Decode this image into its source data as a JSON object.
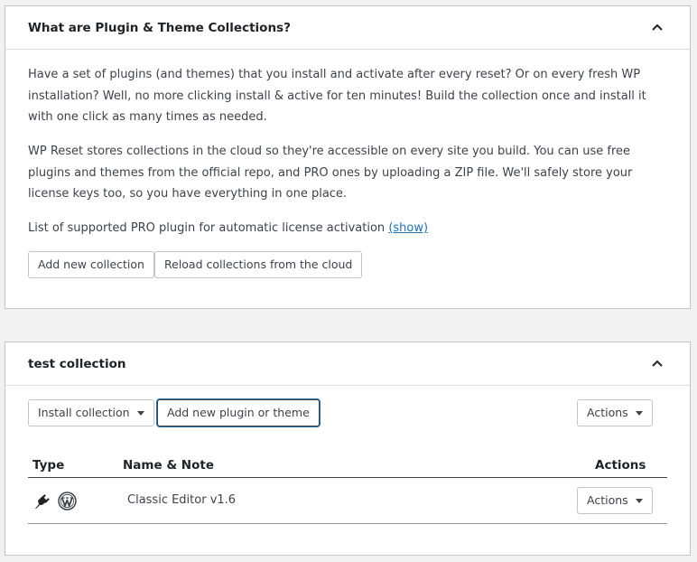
{
  "info_card": {
    "title": "What are Plugin & Theme Collections?",
    "paragraph1": "Have a set of plugins (and themes) that you install and activate after every reset? Or on every fresh WP installation? Well, no more clicking install & active for ten minutes! Build the collection once and install it with one click as many times as needed.",
    "paragraph2": "WP Reset stores collections in the cloud so they're accessible on every site you build. You can use free plugins and themes from the official repo, and PRO ones by uploading a ZIP file. We'll safely store your license keys too, so you have everything in one place.",
    "supported_text": "List of supported PRO plugin for automatic license activation",
    "show_link": "(show)",
    "add_collection_button": "Add new collection",
    "reload_button": "Reload collections from the cloud"
  },
  "collection_card": {
    "title": "test collection",
    "install_button": "Install collection",
    "add_plugin_button": "Add new plugin or theme",
    "actions_button": "Actions",
    "table": {
      "headers": {
        "type": "Type",
        "name": "Name & Note",
        "actions": "Actions"
      },
      "rows": [
        {
          "name": "Classic Editor v1.6",
          "actions_label": "Actions",
          "type_icons": [
            "plug-icon",
            "wordpress-icon"
          ]
        }
      ]
    }
  }
}
